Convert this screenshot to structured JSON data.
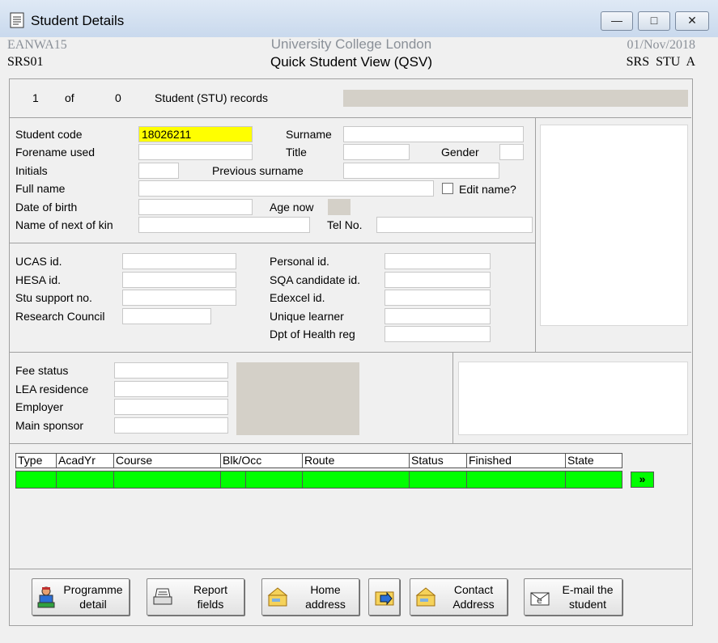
{
  "window": {
    "title": "Student Details",
    "minimize": "—",
    "maximize": "□",
    "close": "✕"
  },
  "header": {
    "left_top": "EANWA15",
    "left_bottom": "SRS01",
    "center_top": "University College London",
    "center_bottom": "Quick Student View (QSV)",
    "right_top": "01/Nov/2018",
    "right_bottom": "SRS  STU  A"
  },
  "records": {
    "current": "1",
    "of_label": "of",
    "total": "0",
    "label": "Student (STU) records"
  },
  "personal": {
    "student_code_label": "Student code",
    "student_code": "18026211",
    "surname_label": "Surname",
    "forename_label": "Forename used",
    "title_label": "Title",
    "gender_label": "Gender",
    "initials_label": "Initials",
    "previous_surname_label": "Previous surname",
    "full_name_label": "Full name",
    "edit_name_label": "Edit name?",
    "dob_label": "Date of birth",
    "age_label": "Age now",
    "next_of_kin_label": "Name of next of kin",
    "tel_label": "Tel No."
  },
  "ids": {
    "ucas_label": "UCAS id.",
    "hesa_label": "HESA id.",
    "stu_support_label": "Stu support no.",
    "research_council_label": "Research Council",
    "personal_label": "Personal id.",
    "sqa_label": "SQA candidate id.",
    "edexcel_label": "Edexcel id.",
    "unique_learner_label": "Unique learner",
    "dpt_health_label": "Dpt of Health reg"
  },
  "fees": {
    "fee_status_label": "Fee status",
    "lea_label": "LEA residence",
    "employer_label": "Employer",
    "sponsor_label": "Main sponsor"
  },
  "table": {
    "columns": [
      "Type",
      "AcadYr",
      "Course",
      "Blk/Occ",
      "Route",
      "Status",
      "Finished",
      "State"
    ],
    "more": "»",
    "row_color": "#00ff00"
  },
  "buttons": {
    "programme": [
      "Programme",
      "detail"
    ],
    "report": [
      "Report",
      "fields"
    ],
    "home": [
      "Home",
      "address"
    ],
    "contact": [
      "Contact",
      "Address"
    ],
    "email": [
      "E-mail the",
      "student"
    ]
  },
  "colors": {
    "highlight": "#ffff00",
    "title_bar": "#c9d9ed",
    "panel": "#f0f0f0"
  }
}
